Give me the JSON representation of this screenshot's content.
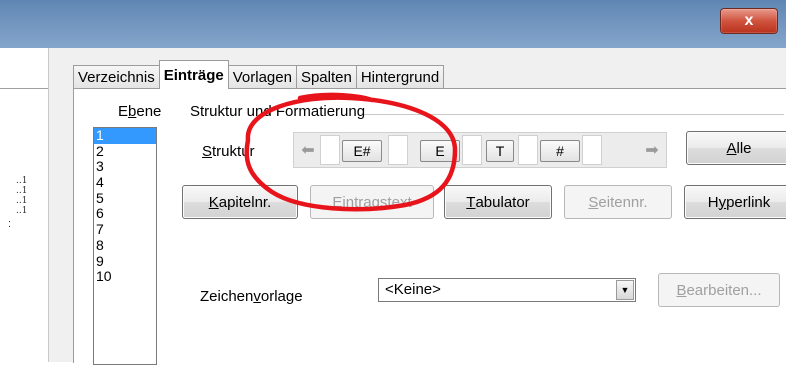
{
  "window": {
    "close_label": "x"
  },
  "left_pane": {
    "dots": "..1\n..1\n..1\n..1",
    "colon": ":"
  },
  "tabs": [
    {
      "label": "Verzeichnis",
      "active": false
    },
    {
      "label": "Einträge",
      "active": true
    },
    {
      "label": "Vorlagen",
      "active": false
    },
    {
      "label": "Spalten",
      "active": false
    },
    {
      "label": "Hintergrund",
      "active": false
    }
  ],
  "ebene": {
    "label_pre": "E",
    "label_ul": "b",
    "label_post": "ene",
    "levels": [
      "1",
      "2",
      "3",
      "4",
      "5",
      "6",
      "7",
      "8",
      "9",
      "10"
    ],
    "selected": "1"
  },
  "group_title": "Struktur und Formatierung",
  "struktur": {
    "label_ul": "S",
    "label_post": "truktur",
    "tokens": [
      "E#",
      "E",
      "T",
      "#"
    ],
    "left_arrow": "⬅",
    "right_arrow": "➡",
    "all_ul": "A",
    "all_post": "lle"
  },
  "buttons": {
    "kapitel": {
      "ul": "K",
      "post": "apitelnr.",
      "enabled": true
    },
    "eintragstext": {
      "ul": "E",
      "post": "intragstext",
      "enabled": false
    },
    "tabulator": {
      "ul": "T",
      "post": "abulator",
      "enabled": true
    },
    "seitennr": {
      "pre": "",
      "ul": "S",
      "post": "eitennr.",
      "enabled": false
    },
    "hyperlink": {
      "pre": "H",
      "ul": "y",
      "post": "perlink",
      "enabled": true
    }
  },
  "zeichenvorlage": {
    "label_pre": "Zeichen",
    "label_ul": "v",
    "label_post": "orlage",
    "value": "<Keine>",
    "edit_ul": "B",
    "edit_post": "earbeiten..."
  },
  "annotation": {
    "color": "#e8141c"
  }
}
